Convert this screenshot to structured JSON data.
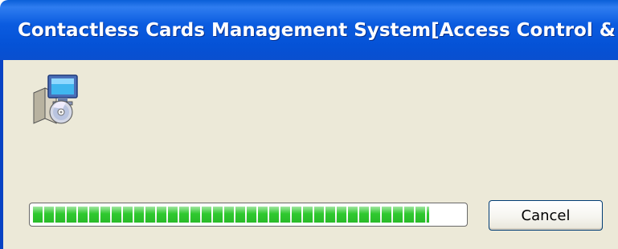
{
  "window": {
    "title": "Contactless Cards Management System[Access Control & A..."
  },
  "icon": {
    "name": "installer-icon"
  },
  "progress": {
    "fraction": 0.92,
    "color": "#2fc92f"
  },
  "buttons": {
    "cancel_label": "Cancel"
  },
  "colors": {
    "titlebar": "#0a5fd8",
    "client_background": "#ece9d8"
  }
}
